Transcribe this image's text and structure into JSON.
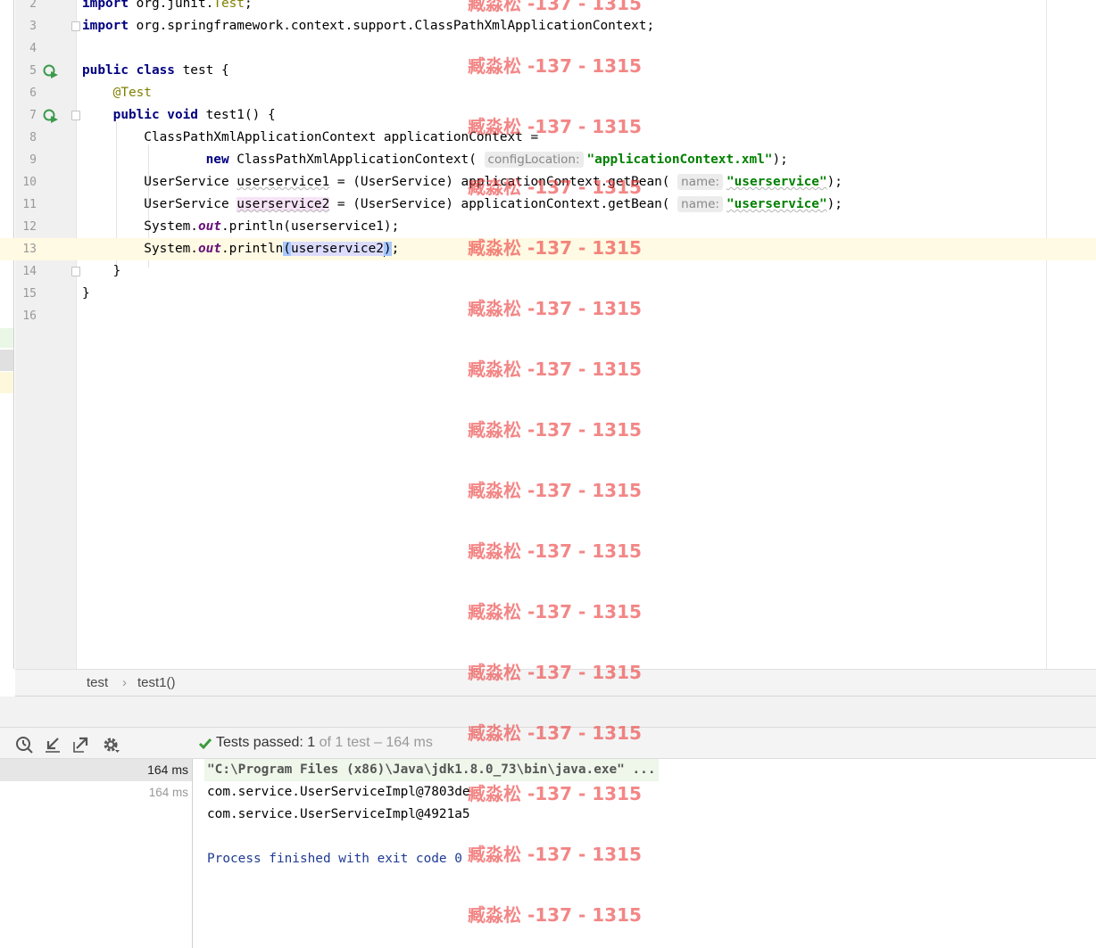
{
  "editor": {
    "lines": [
      {
        "n": "2",
        "c": "import org.junit.Test;"
      },
      {
        "n": "3",
        "c": "import org.springframework.context.support.ClassPathXmlApplicationContext;"
      },
      {
        "n": "4",
        "c": ""
      },
      {
        "n": "5",
        "c": "public class test {"
      },
      {
        "n": "6",
        "c": "@Test"
      },
      {
        "n": "7",
        "c": "public void test1() {"
      },
      {
        "n": "8",
        "c": "ClassPathXmlApplicationContext applicationContext ="
      },
      {
        "n": "9",
        "c": "new ClassPathXmlApplicationContext( configLocation: \"applicationContext.xml\");"
      },
      {
        "n": "10",
        "c": "UserService userservice1 = (UserService) applicationContext.getBean( name: \"userservice\");"
      },
      {
        "n": "11",
        "c": "UserService userservice2 = (UserService) applicationContext.getBean( name: \"userservice\");"
      },
      {
        "n": "12",
        "c": "System.out.println(userservice1);"
      },
      {
        "n": "13",
        "c": "System.out.println(userservice2);"
      },
      {
        "n": "14",
        "c": "}"
      },
      {
        "n": "15",
        "c": "}"
      },
      {
        "n": "16",
        "c": ""
      }
    ],
    "gutter_icons": [
      "run-test-icon",
      "run-test-icon"
    ],
    "accent_colors": {
      "keyword": "#000080",
      "string": "#008000",
      "annotation": "#808000",
      "field": "#660e7a"
    }
  },
  "breadcrumb": {
    "class_name": "test",
    "separator": "›",
    "method_name": "test1()"
  },
  "run_panel": {
    "status_prefix": "Tests passed:",
    "status_count": "1",
    "status_suffix": "of 1 test – 164 ms",
    "status_icon": "check-icon",
    "toolbar_icons": [
      "history-icon",
      "import-tests-icon",
      "export-tests-icon",
      "settings-icon"
    ],
    "tree_rows": [
      "164 ms",
      "164 ms"
    ],
    "console_lines": [
      "\"C:\\Program Files (x86)\\Java\\jdk1.8.0_73\\bin\\java.exe\" ...",
      "com.service.UserServiceImpl@7803de",
      "com.service.UserServiceImpl@4921a5",
      "",
      "Process finished with exit code 0"
    ]
  },
  "watermark": "臧淼松 -137 - 1315"
}
